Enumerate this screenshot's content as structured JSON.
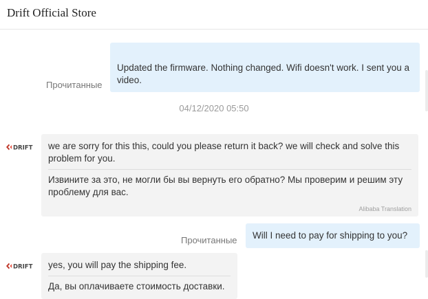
{
  "header": {
    "title": "Drift Official Store"
  },
  "messages": [
    {
      "direction": "out",
      "text": "Updated the firmware. Nothing changed. Wifi doesn't work. I sent you a video.",
      "status": "Прочитанные"
    },
    {
      "direction": "timestamp",
      "text": "04/12/2020 05:50"
    },
    {
      "direction": "in",
      "sender_icon": "drift-logo-icon",
      "text": "we are sorry for this this, could you please return it back? we will check and solve this problem for you.",
      "translation": "Извините за это, не могли бы вы вернуть его обратно? Мы проверим и решим эту проблему для вас.",
      "translation_credit": "Alibaba Translation"
    },
    {
      "direction": "out",
      "text": "Will I need to pay for shipping to you?",
      "status": "Прочитанные"
    },
    {
      "direction": "in",
      "sender_icon": "drift-logo-icon",
      "text": "yes, you will pay the shipping fee.",
      "translation": "Да, вы оплачиваете стоимость доставки."
    }
  ],
  "brand": {
    "logo_text": "DRIFT",
    "logo_color": "#c0392b"
  },
  "colors": {
    "outgoing_bubble": "#e3f1fc",
    "incoming_bubble": "#f3f3f3"
  }
}
